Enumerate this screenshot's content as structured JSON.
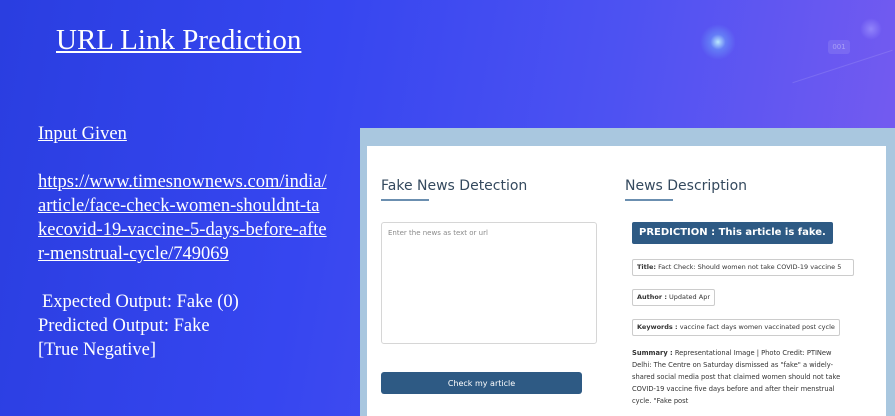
{
  "slide": {
    "title": "URL Link Prediction",
    "input_heading": "Input Given",
    "url": "https://www.timesnownews.com/india/article/face-check-women-shouldnt-takecovid-19-vaccine-5-days-before-after-menstrual-cycle/749069",
    "expected_output": "Expected Output: Fake (0)",
    "predicted_output": "Predicted Output: Fake",
    "classification": "[True Negative]",
    "decor_bubble": "001"
  },
  "app": {
    "left_panel_title": "Fake News Detection",
    "input_placeholder": "Enter the news as text or url",
    "button_label": "Check my article",
    "right_panel_title": "News Description",
    "prediction": "PREDICTION : This article is fake.",
    "title_label": "Title:",
    "title_value": "Fact Check: Should women not take COVID-19 vaccine 5",
    "author_label": "Author :",
    "author_value": "Updated Apr",
    "keywords_label": "Keywords :",
    "keywords_value": "vaccine fact days women vaccinated post cycle",
    "summary_label": "Summary :",
    "summary_value": "Representational Image | Photo Credit: PTINew Delhi: The Centre on Saturday dismissed as \"fake\" a widely-shared social media post that claimed women should not take COVID-19 vaccine five days before and after their menstrual cycle. \"Fake post"
  },
  "colors": {
    "background_start": "#2a3ee0",
    "background_end": "#7a5cf0",
    "frame": "#a9c7df",
    "button": "#2e5a84",
    "panel_title": "#34495e"
  }
}
